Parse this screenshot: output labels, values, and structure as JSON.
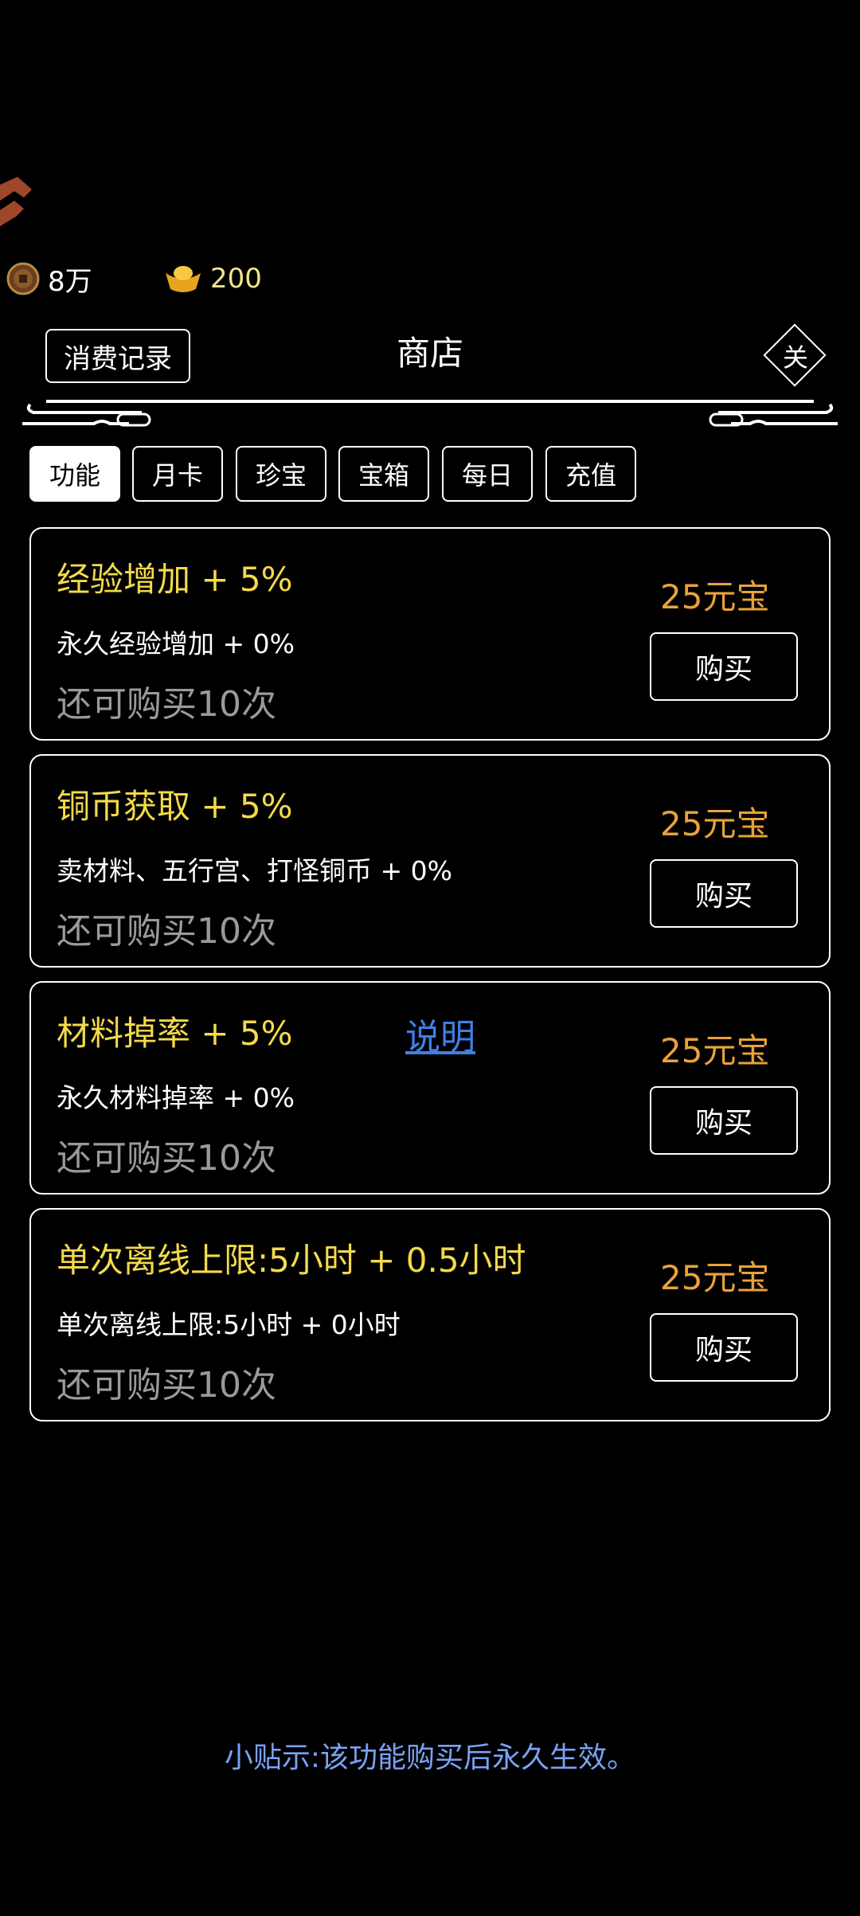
{
  "currency": {
    "coins": "8万",
    "ingots": "200"
  },
  "header": {
    "history_label": "消费记录",
    "title": "商店",
    "close_label": "关"
  },
  "tabs": [
    {
      "label": "功能",
      "active": true
    },
    {
      "label": "月卡"
    },
    {
      "label": "珍宝"
    },
    {
      "label": "宝箱"
    },
    {
      "label": "每日"
    },
    {
      "label": "充值"
    }
  ],
  "items": [
    {
      "title": "经验增加 + 5%",
      "desc": "永久经验增加 + 0%",
      "remain": "还可购买10次",
      "price": "25元宝",
      "buy_label": "购买"
    },
    {
      "title": "铜币获取 + 5%",
      "desc": "卖材料、五行宫、打怪铜币 + 0%",
      "remain": "还可购买10次",
      "price": "25元宝",
      "buy_label": "购买"
    },
    {
      "title": "材料掉率 + 5%",
      "desc": "永久材料掉率 + 0%",
      "remain": "还可购买10次",
      "price": "25元宝",
      "buy_label": "购买",
      "link": "说明"
    },
    {
      "title": "单次离线上限:5小时 + 0.5小时",
      "desc": "单次离线上限:5小时 + 0小时",
      "remain": "还可购买10次",
      "price": "25元宝",
      "buy_label": "购买"
    }
  ],
  "tip": "小贴示:该功能购买后永久生效。",
  "colors": {
    "title_yellow": "#f3da4a",
    "price_orange": "#e9a23a",
    "tip_blue": "#7aa2f5",
    "link_blue": "#3f7fe6",
    "remain_gray": "#9a9a9a"
  }
}
